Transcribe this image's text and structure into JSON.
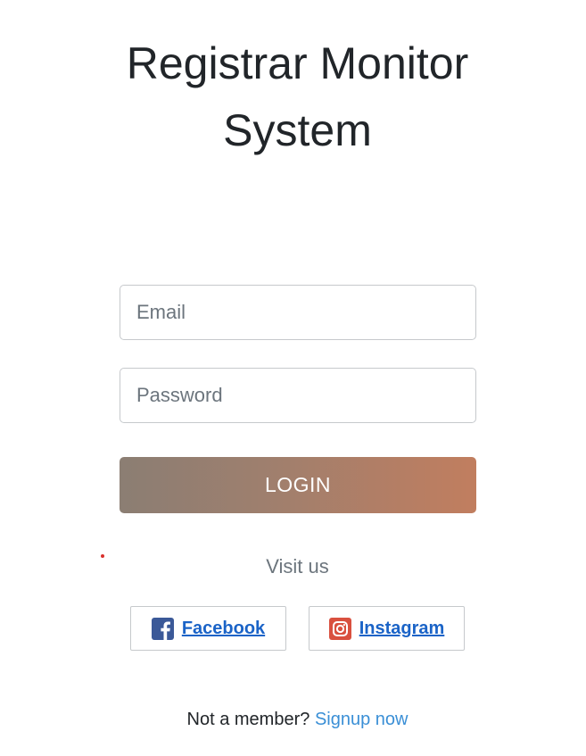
{
  "header": {
    "title_line1": "Registrar Monitor",
    "title_line2": "System"
  },
  "form": {
    "email_placeholder": "Email",
    "email_value": "",
    "password_placeholder": "Password",
    "password_value": "",
    "login_label": "LOGIN"
  },
  "social": {
    "heading": "Visit us",
    "facebook_label": "Facebook",
    "instagram_label": "Instagram",
    "facebook_icon": "facebook-icon",
    "instagram_icon": "instagram-icon"
  },
  "footer": {
    "prompt": "Not a member?",
    "signup_label": "Signup now"
  },
  "colors": {
    "gradient_start": "#8b7e73",
    "gradient_end": "#c17e5f",
    "link": "#1a63c7",
    "signup": "#3a8fd6",
    "facebook": "#3b5998",
    "instagram": "#d9503f"
  }
}
